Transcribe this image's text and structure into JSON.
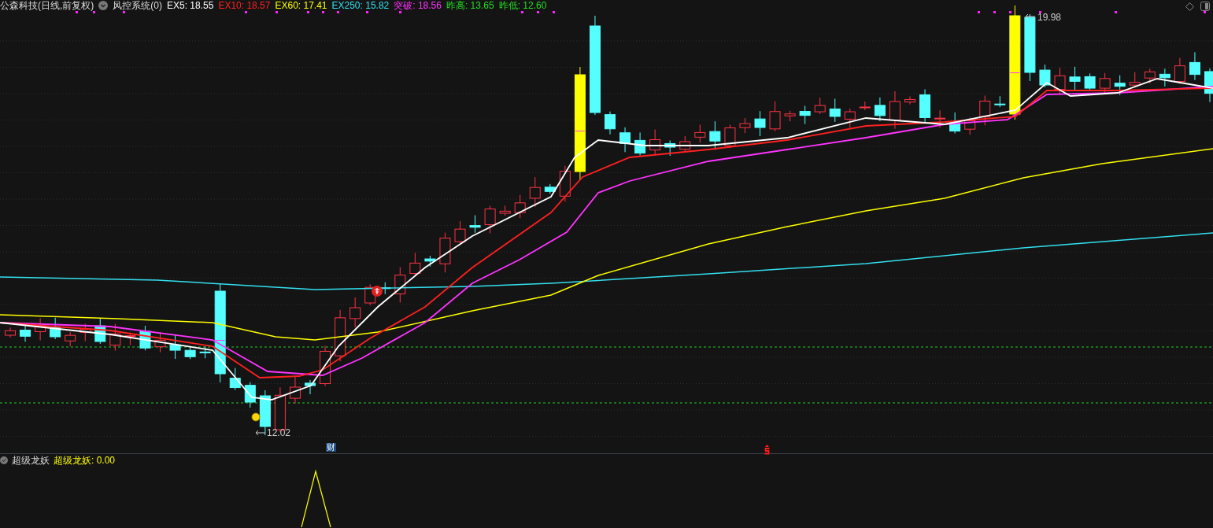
{
  "header": {
    "title": "公森科技(日线,前复权)",
    "indicator": "风控系统(0)",
    "legend": [
      {
        "label": "EX5: 18.55",
        "color": "#ffffff"
      },
      {
        "label": "EX10: 18.57",
        "color": "#ff2020"
      },
      {
        "label": "EX60: 17.41",
        "color": "#ffff00"
      },
      {
        "label": "EX250: 15.82",
        "color": "#33e0f0"
      },
      {
        "label": "突破: 18.56",
        "color": "#ff33ff"
      },
      {
        "label": "昨高: 13.65",
        "color": "#22dd22"
      },
      {
        "label": "昨低: 12.60",
        "color": "#22dd22"
      }
    ]
  },
  "price_labels": {
    "high": "19.98",
    "low": "12.02"
  },
  "event_badge": "财",
  "lower_panel": {
    "name": "超级龙妖",
    "reading": "超级龙妖: 0.00"
  }
}
